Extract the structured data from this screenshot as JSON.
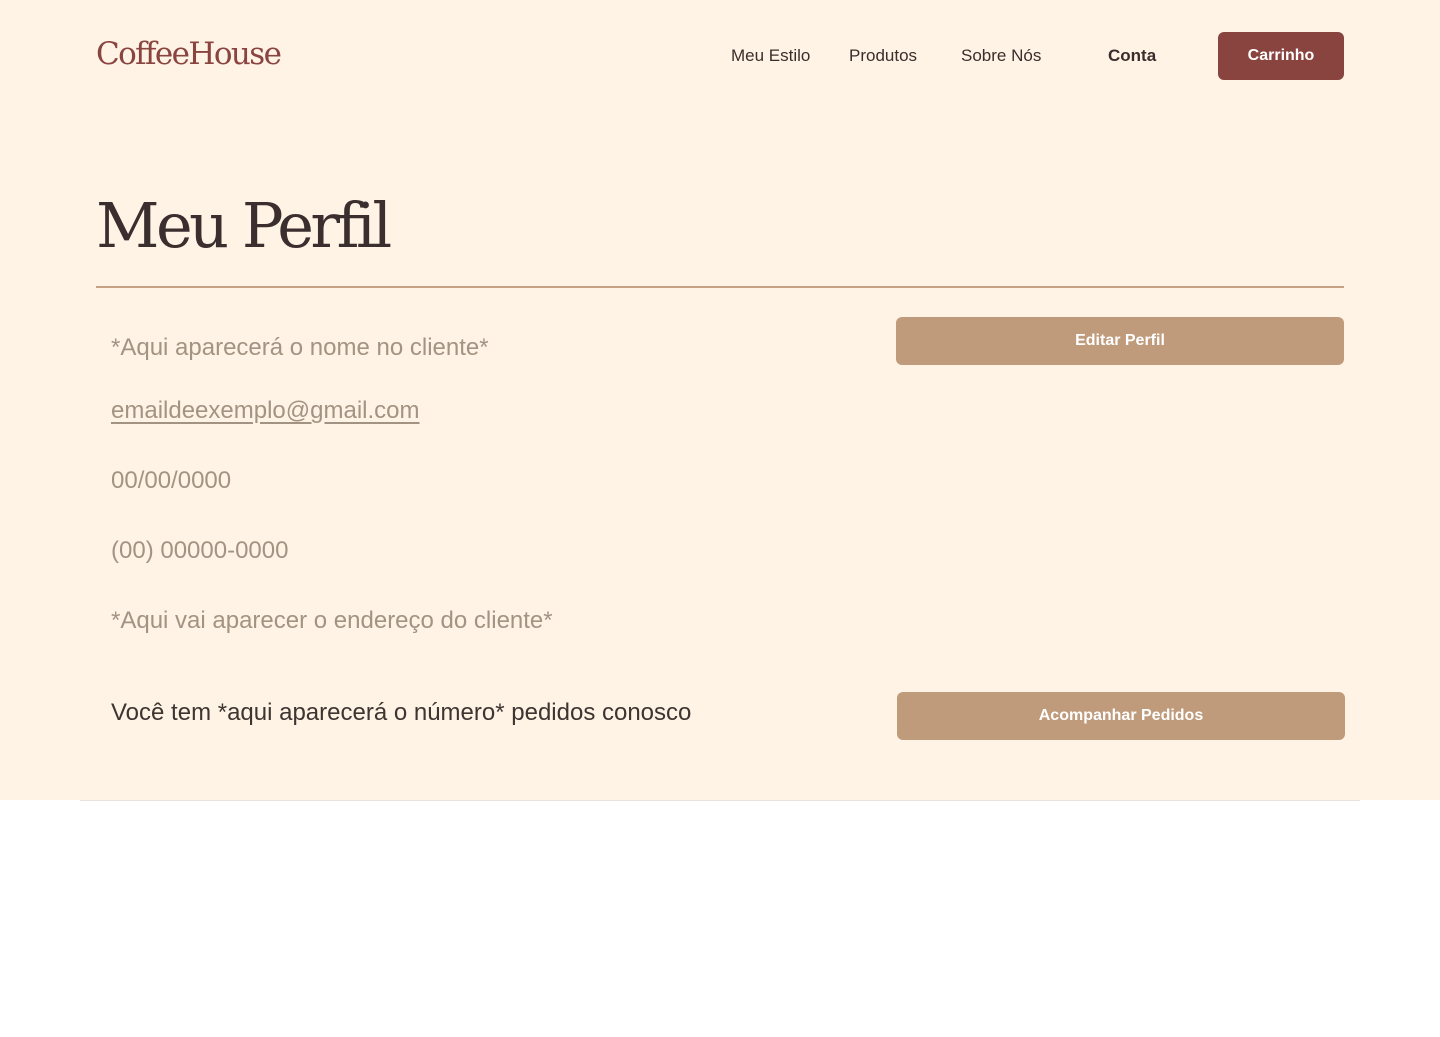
{
  "header": {
    "logo": "CoffeeHouse",
    "nav": [
      {
        "label": "Meu Estilo"
      },
      {
        "label": "Produtos"
      },
      {
        "label": "Sobre Nós"
      },
      {
        "label": "Conta"
      }
    ],
    "cart_label": "Carrinho"
  },
  "profile": {
    "title": "Meu Perfil",
    "name": "*Aqui aparecerá o nome no cliente*",
    "email": "emaildeexemplo@gmail.com",
    "birthdate": "00/00/0000",
    "phone": "(00) 00000-0000",
    "address": "*Aqui vai aparecer o endereço do cliente*",
    "edit_label": "Editar Perfil",
    "orders_text": "Você tem *aqui aparecerá o número* pedidos conosco",
    "track_orders_label": "Acompanhar Pedidos"
  },
  "colors": {
    "background": "#fff3e5",
    "brand": "#8a4440",
    "accent_button": "#bf9b7c",
    "divider": "#c7a183",
    "muted_text": "#a39382",
    "heading_text": "#3b2e2e"
  }
}
